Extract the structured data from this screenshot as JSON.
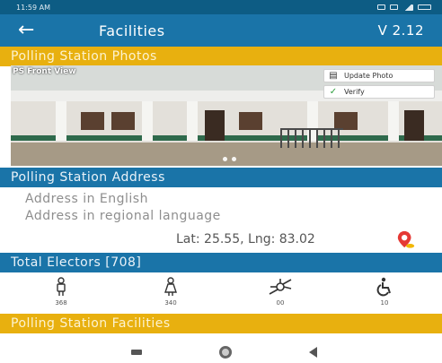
{
  "status_bar": {
    "time": "11:59 AM",
    "icons": [
      "sim-icon",
      "notification-icon",
      "signal-icon",
      "battery-icon"
    ]
  },
  "app_bar": {
    "back_icon": "arrow-left-icon",
    "title": "Facilities",
    "version": "V 2.12"
  },
  "sections": {
    "photos_header": "Polling Station Photos",
    "address_header": "Polling Station Address",
    "electors_header": "Total Electors [708]",
    "facilities_header": "Polling Station Facilities"
  },
  "photo_card": {
    "label": "PS Front View",
    "update_button": "Update Photo",
    "verify_button": "Verify",
    "carousel_pages": 2
  },
  "address": {
    "english_placeholder": "Address in English",
    "regional_placeholder": "Address in regional language",
    "latlng": "Lat: 25.55, Lng: 83.02",
    "map_icon": "map-pin-icon"
  },
  "electors": [
    {
      "icon": "male-voter-icon",
      "count": "368"
    },
    {
      "icon": "female-voter-icon",
      "count": "340"
    },
    {
      "icon": "third-gender-icon",
      "count": "00"
    },
    {
      "icon": "wheelchair-icon",
      "count": "10"
    }
  ],
  "nav_bar": {
    "icons": [
      "recent-apps-icon",
      "home-icon",
      "back-icon"
    ]
  },
  "colors": {
    "status_bar": "#0d5c84",
    "primary_blue": "#1a74a8",
    "accent_gold": "#e8b00f",
    "verify_green": "#2e9e3e",
    "pin_red": "#e53935"
  }
}
